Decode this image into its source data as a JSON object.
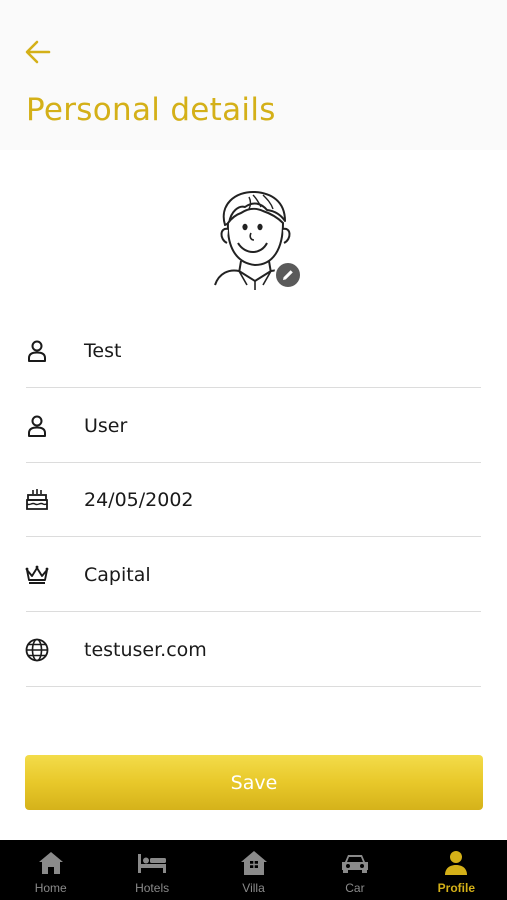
{
  "header": {
    "title": "Personal details",
    "back_icon": "arrow-left-icon"
  },
  "avatar": {
    "icon": "cartoon-avatar",
    "edit_icon": "pencil-icon"
  },
  "fields": [
    {
      "icon": "person-icon",
      "value": "Test"
    },
    {
      "icon": "person-icon",
      "value": "User"
    },
    {
      "icon": "birthday-cake-icon",
      "value": "24/05/2002"
    },
    {
      "icon": "crown-icon",
      "value": "Capital"
    },
    {
      "icon": "globe-icon",
      "value": "testuser.com"
    }
  ],
  "save_label": "Save",
  "tabs": [
    {
      "label": "Home",
      "icon": "home-icon",
      "active": false
    },
    {
      "label": "Hotels",
      "icon": "bed-icon",
      "active": false
    },
    {
      "label": "Villa",
      "icon": "villa-icon",
      "active": false
    },
    {
      "label": "Car",
      "icon": "car-icon",
      "active": false
    },
    {
      "label": "Profile",
      "icon": "profile-icon",
      "active": true
    }
  ],
  "colors": {
    "accent": "#d4b018",
    "tabbar_bg": "#000000",
    "tab_inactive": "#8a8a8a",
    "save_gradient_top": "#f3dc4a",
    "save_gradient_bottom": "#d5b21a"
  }
}
